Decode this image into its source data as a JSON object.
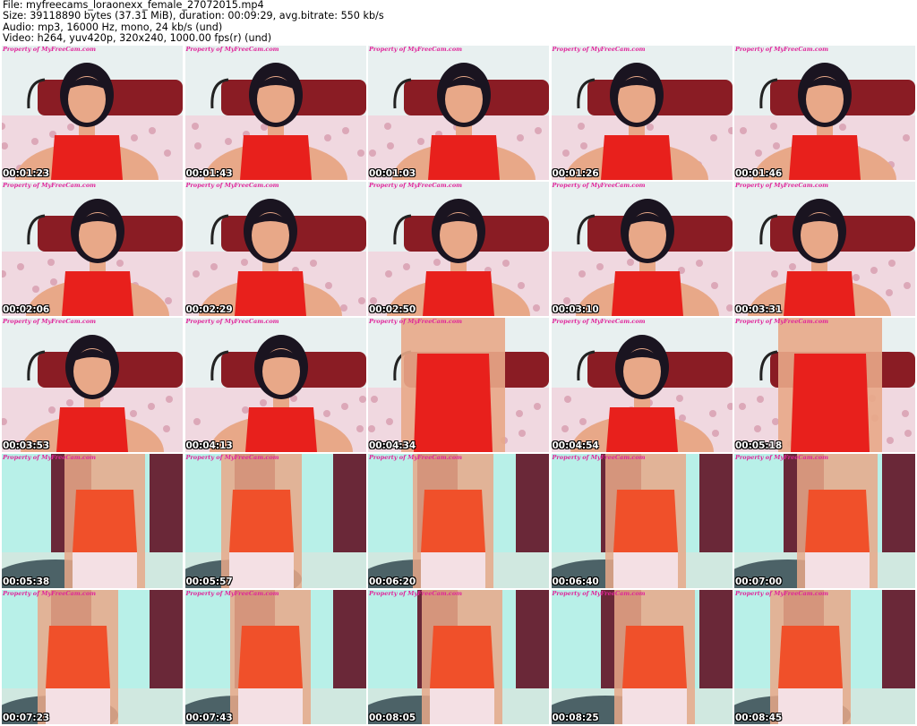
{
  "header": {
    "file_line": "File: myfreecams_loraonexx_female_27072015.mp4",
    "size_line": "Size: 39118890 bytes (37.31 MiB), duration: 00:09:29, avg.bitrate: 550 kb/s",
    "audio_line": "Audio: mp3, 16000 Hz, mono, 24 kb/s (und)",
    "video_line": "Video: h264, yuv420p, 320x240, 1000.00 fps(r) (und)"
  },
  "watermark": "Property of MyFreeCam.com",
  "thumbnails": [
    {
      "time": "00:01:23",
      "scene": "bedroom",
      "subject": "face"
    },
    {
      "time": "00:01:43",
      "scene": "bedroom",
      "subject": "face"
    },
    {
      "time": "00:01:03",
      "scene": "bedroom",
      "subject": "face"
    },
    {
      "time": "00:01:26",
      "scene": "bedroom",
      "subject": "face"
    },
    {
      "time": "00:01:46",
      "scene": "bedroom",
      "subject": "face"
    },
    {
      "time": "00:02:06",
      "scene": "bedroom",
      "subject": "face"
    },
    {
      "time": "00:02:29",
      "scene": "bedroom",
      "subject": "face"
    },
    {
      "time": "00:02:50",
      "scene": "bedroom",
      "subject": "face"
    },
    {
      "time": "00:03:10",
      "scene": "bedroom",
      "subject": "face"
    },
    {
      "time": "00:03:31",
      "scene": "bedroom",
      "subject": "face"
    },
    {
      "time": "00:03:53",
      "scene": "bedroom",
      "subject": "face"
    },
    {
      "time": "00:04:13",
      "scene": "bedroom",
      "subject": "face"
    },
    {
      "time": "00:04:34",
      "scene": "bedroom",
      "subject": "torso"
    },
    {
      "time": "00:04:54",
      "scene": "bedroom",
      "subject": "face"
    },
    {
      "time": "00:05:18",
      "scene": "bedroom",
      "subject": "torso"
    },
    {
      "time": "00:05:38",
      "scene": "room",
      "subject": "torso"
    },
    {
      "time": "00:05:57",
      "scene": "room",
      "subject": "torso"
    },
    {
      "time": "00:06:20",
      "scene": "room",
      "subject": "torso"
    },
    {
      "time": "00:06:40",
      "scene": "room",
      "subject": "torso"
    },
    {
      "time": "00:07:00",
      "scene": "room",
      "subject": "torso"
    },
    {
      "time": "00:07:23",
      "scene": "room",
      "subject": "torso"
    },
    {
      "time": "00:07:43",
      "scene": "room",
      "subject": "torso"
    },
    {
      "time": "00:08:05",
      "scene": "room",
      "subject": "torso"
    },
    {
      "time": "00:08:25",
      "scene": "room",
      "subject": "torso"
    },
    {
      "time": "00:08:45",
      "scene": "room",
      "subject": "torso"
    }
  ],
  "colors": {
    "top_red": "#e8201c",
    "headboard": "#8a1c24",
    "bedsheet": "#f0d8e0",
    "wall_light": "#e8f0f0",
    "curtain": "#6a2838",
    "wall_cyan": "#b8f0e8",
    "skin": "#e8a888",
    "hair": "#1a1420"
  }
}
